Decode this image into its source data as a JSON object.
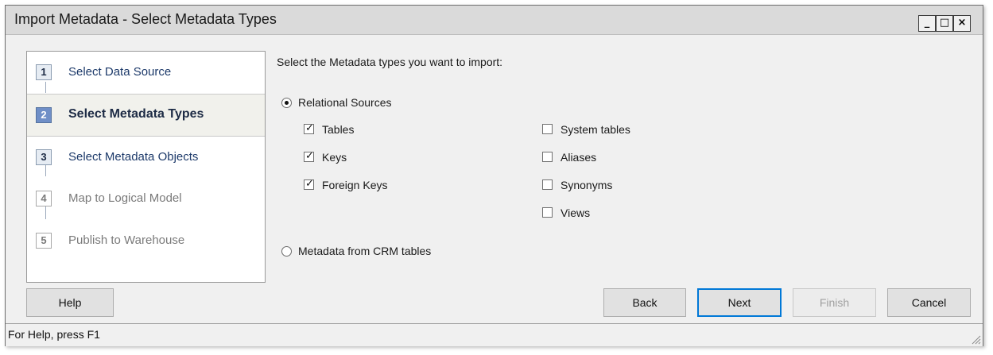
{
  "window": {
    "title": "Import Metadata - Select Metadata Types",
    "controls": {
      "minimize": "_",
      "maximize": "□",
      "close": "×"
    }
  },
  "steps": [
    {
      "num": "1",
      "label": "Select Data Source",
      "state": "done"
    },
    {
      "num": "2",
      "label": "Select Metadata Types",
      "state": "active"
    },
    {
      "num": "3",
      "label": "Select Metadata Objects",
      "state": "enabled"
    },
    {
      "num": "4",
      "label": "Map to Logical Model",
      "state": "disabled"
    },
    {
      "num": "5",
      "label": "Publish to Warehouse",
      "state": "disabled"
    }
  ],
  "content": {
    "prompt": "Select the Metadata types you want to import:",
    "radio_relational": {
      "label": "Relational Sources",
      "selected": true
    },
    "radio_crm": {
      "label": "Metadata from CRM tables",
      "selected": false
    },
    "checkboxes_left": [
      {
        "label": "Tables",
        "checked": true
      },
      {
        "label": "Keys",
        "checked": true
      },
      {
        "label": "Foreign Keys",
        "checked": true
      }
    ],
    "checkboxes_right": [
      {
        "label": "System tables",
        "checked": false
      },
      {
        "label": "Aliases",
        "checked": false
      },
      {
        "label": "Synonyms",
        "checked": false
      },
      {
        "label": "Views",
        "checked": false
      }
    ]
  },
  "buttons": {
    "help": "Help",
    "back": "Back",
    "next": "Next",
    "finish": "Finish",
    "cancel": "Cancel"
  },
  "status": {
    "text": "For Help, press F1"
  }
}
